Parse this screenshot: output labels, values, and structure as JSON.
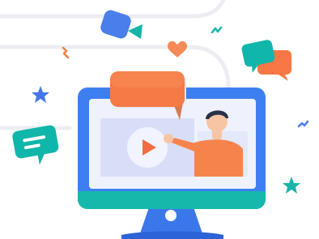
{
  "scene": {
    "subject": "video-call-illustration",
    "video_content": "play-button-and-presenter"
  },
  "palette": {
    "background": "#ffffff",
    "track_lines": "#ebedf2",
    "monitor_frame": "#3d7ff0",
    "monitor_bezel": "#16b8ac",
    "monitor_stand": "#3a78ea",
    "monitor_screen": "#eff2fc",
    "video_panel": "#d9def8",
    "play_circle": "#f1f4ff",
    "play_arrow": "#f26c43",
    "speech_bubble_orange": "#f57a45",
    "skin": "#f7c5a4",
    "hair": "#293247",
    "shirt": "#f7834c",
    "chat_bubble_teal": "#10b6a9",
    "chat_bubble_orange": "#f87745",
    "camera_blue": "#4a7eeb",
    "camera_teal": "#14b4a7",
    "star_blue": "#4677ea",
    "star_teal": "#19b5a9",
    "heart": "#f68b58",
    "squiggle_teal": "#1db7aa",
    "squiggle_orange": "#f37e46",
    "squiggle_blue": "#4c7de8"
  },
  "icons": [
    "video-camera-icon",
    "heart-icon",
    "chat-bubbles-icon",
    "star-icon",
    "message-bubble-icon",
    "play-icon",
    "speech-bubble-icon",
    "presenter-avatar-icon"
  ]
}
